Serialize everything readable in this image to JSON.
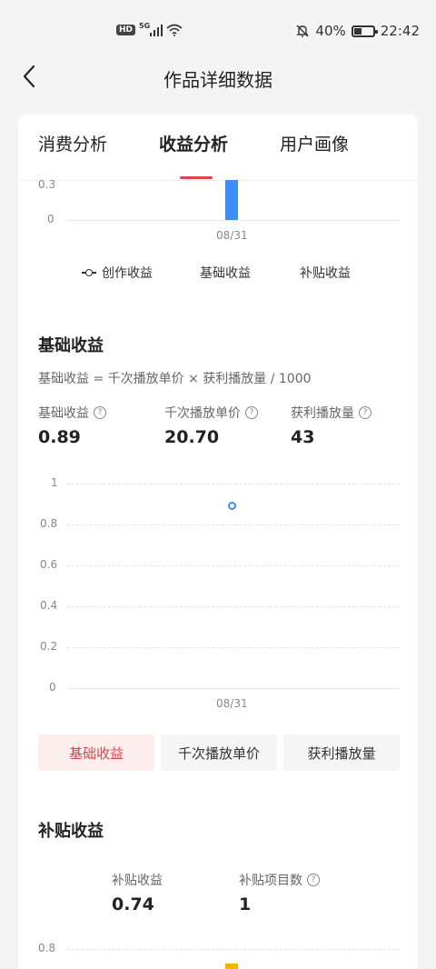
{
  "status_bar": {
    "hd": "HD",
    "network": "5G",
    "battery": "40%",
    "time": "22:42"
  },
  "header": {
    "title": "作品详细数据"
  },
  "tabs": [
    {
      "label": "消费分析"
    },
    {
      "label": "收益分析"
    },
    {
      "label": "用户画像"
    }
  ],
  "top_chart": {
    "y_ticks": [
      "0.3",
      "0"
    ],
    "x_label": "08/31",
    "legend": [
      {
        "label": "创作收益"
      },
      {
        "label": "基础收益"
      },
      {
        "label": "补贴收益"
      }
    ],
    "colors": {
      "bar": "#3d8ef7"
    }
  },
  "base_income": {
    "title": "基础收益",
    "formula": "基础收益 = 千次播放单价 × 获利播放量 / 1000",
    "metrics": [
      {
        "label": "基础收益",
        "value": "0.89"
      },
      {
        "label": "千次播放单价",
        "value": "20.70"
      },
      {
        "label": "获利播放量",
        "value": "43"
      }
    ],
    "chart_y_ticks": [
      "1",
      "0.8",
      "0.6",
      "0.4",
      "0.2",
      "0"
    ],
    "chart_x_label": "08/31",
    "buttons": [
      "基础收益",
      "千次播放单价",
      "获利播放量"
    ]
  },
  "subsidy_income": {
    "title": "补贴收益",
    "metrics": [
      {
        "label": "补贴收益",
        "value": "0.74"
      },
      {
        "label": "补贴项目数",
        "value": "1"
      }
    ],
    "chart_y_ticks": [
      "0.8"
    ]
  },
  "chart_data": {
    "type": "scatter",
    "categories": [
      "08/31"
    ],
    "series": [
      {
        "values": [
          0.89
        ]
      }
    ],
    "ylim": [
      0,
      1
    ],
    "grid": true,
    "colors": {
      "point": "#3d8ef7"
    }
  }
}
